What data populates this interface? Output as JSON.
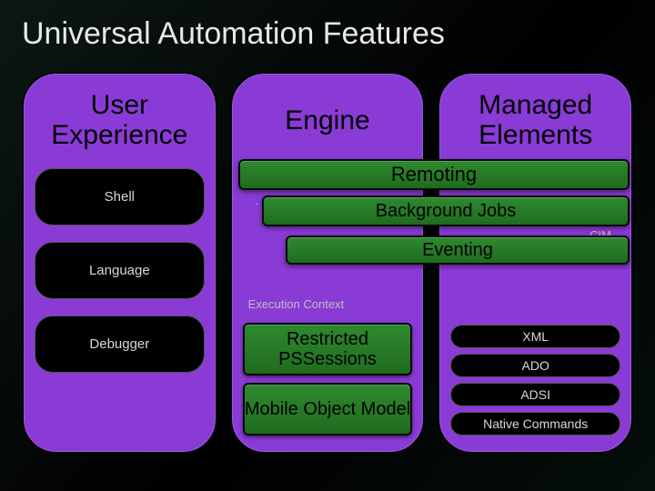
{
  "title": "Universal Automation Features",
  "columns": {
    "ux": {
      "heading": "User Experience",
      "items": [
        "Shell",
        "Language",
        "Debugger"
      ]
    },
    "engine": {
      "heading": "Engine",
      "restricted": "Restricted PSSessions",
      "mobile": "Mobile Object Model",
      "behind_context": "Execution Context",
      "behind_dot": "."
    },
    "managed": {
      "heading": "Managed Elements",
      "items": [
        "XML",
        "ADO",
        "ADSI",
        "Native Commands"
      ],
      "behind_cim": "CIM"
    }
  },
  "overlays": {
    "remoting": "Remoting",
    "background_jobs": "Background Jobs",
    "eventing": "Eventing"
  }
}
